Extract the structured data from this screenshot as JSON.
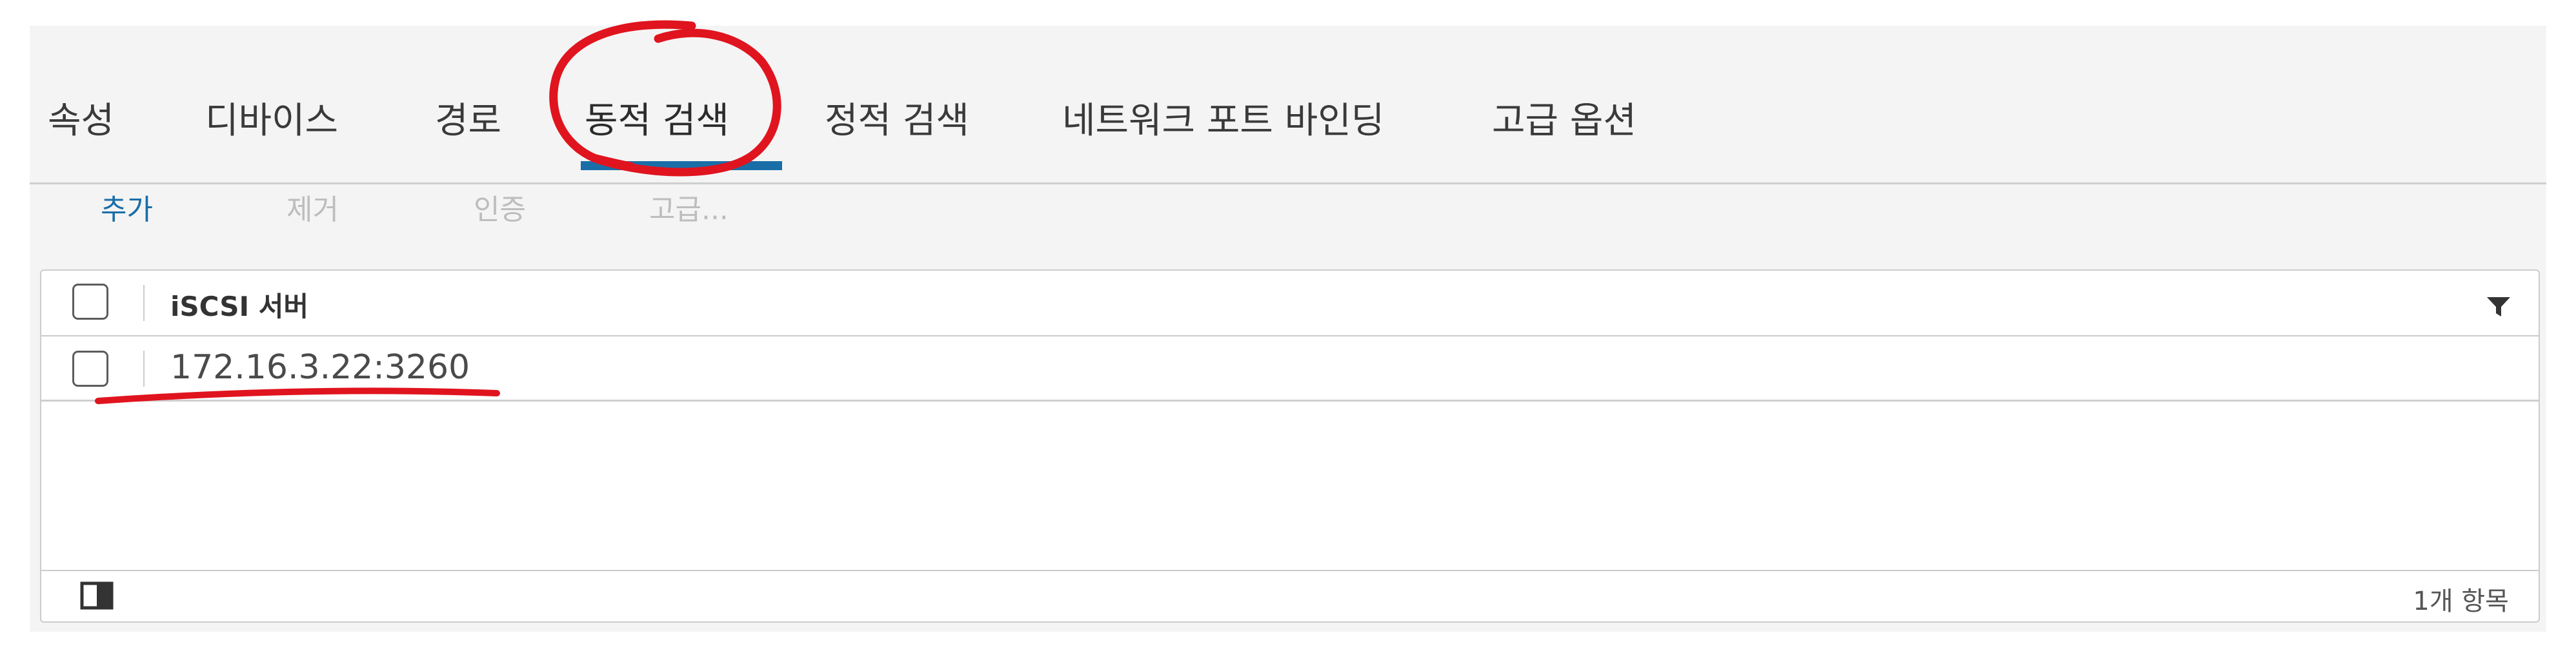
{
  "tabs": [
    {
      "label": "속성"
    },
    {
      "label": "디바이스"
    },
    {
      "label": "경로"
    },
    {
      "label": "동적 검색"
    },
    {
      "label": "정적 검색"
    },
    {
      "label": "네트워크 포트 바인딩"
    },
    {
      "label": "고급 옵션"
    }
  ],
  "active_tab": "동적 검색",
  "toolbar": {
    "add_label": "추가",
    "remove_label": "제거",
    "auth_label": "인증",
    "advanced_label": "고급..."
  },
  "grid": {
    "column_header": "iSCSI 서버",
    "rows": [
      {
        "server": "172.16.3.22:3260"
      }
    ],
    "footer_count": "1개 항목"
  },
  "colors": {
    "accent": "#1a6ea8",
    "annotation": "#e0141e",
    "panel_bg": "#f4f4f4"
  },
  "icons": {
    "filter": "filter-icon",
    "column_toggle": "column-toggle-icon"
  }
}
